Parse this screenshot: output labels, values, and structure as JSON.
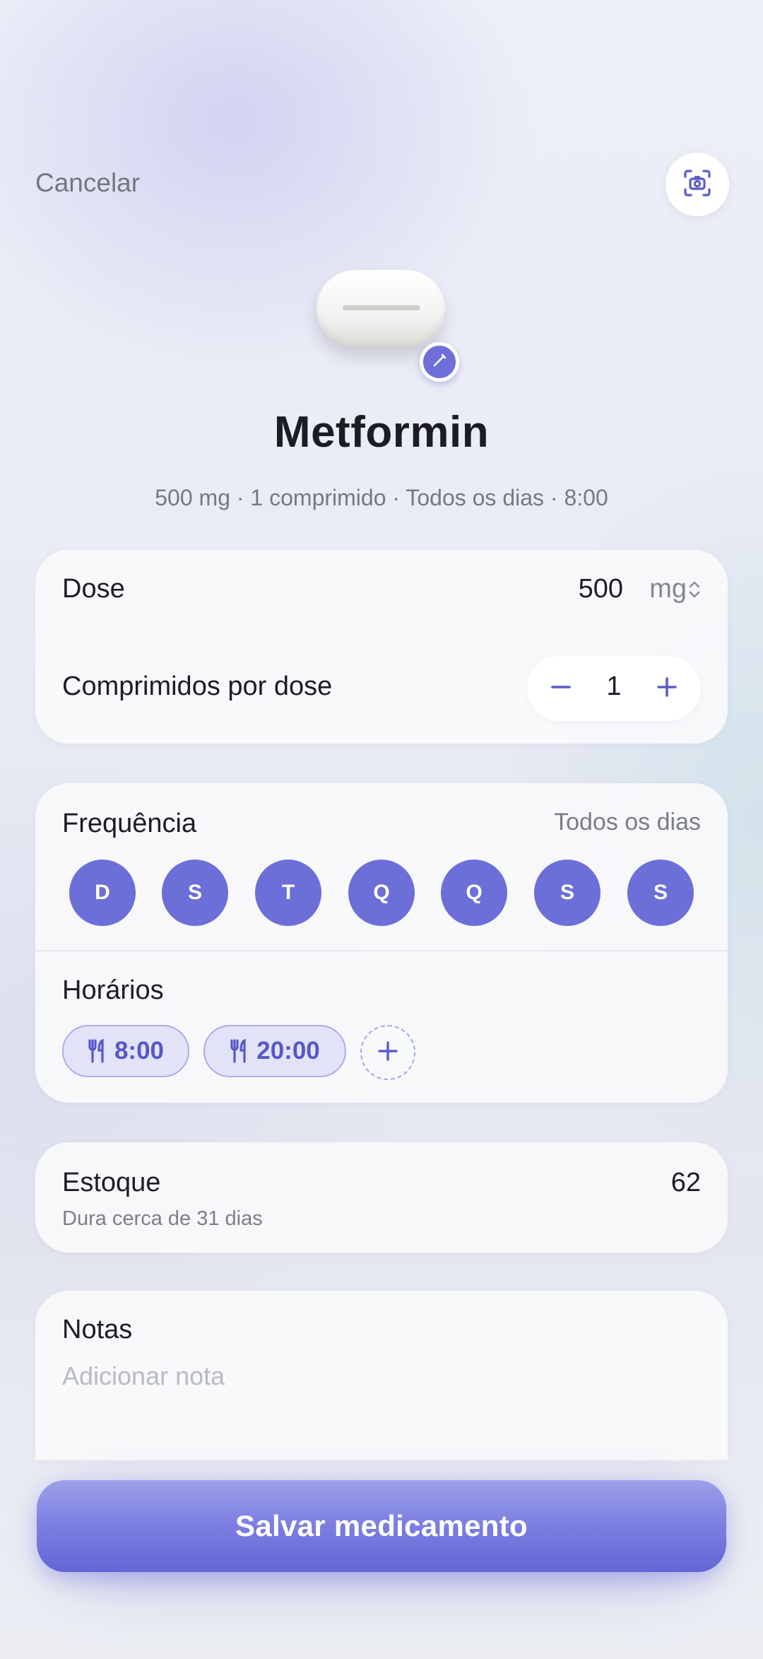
{
  "header": {
    "cancel_label": "Cancelar",
    "scan_icon": "camera-scan-icon"
  },
  "medication": {
    "pill_icon": "pill-icon",
    "edit_icon": "pencil-icon",
    "name": "Metformin",
    "summary": "500 mg · 1 comprimido · Todos os dias · 8:00"
  },
  "dose_card": {
    "dose_label": "Dose",
    "dose_value": "500",
    "dose_unit": "mg",
    "unit_icon": "chevron-up-down-icon",
    "pills_label": "Comprimidos por dose",
    "pills_value": "1",
    "minus_icon": "minus-icon",
    "plus_icon": "plus-icon"
  },
  "frequency_card": {
    "label": "Frequência",
    "value": "Todos os dias",
    "days": [
      {
        "letter": "D",
        "selected": true
      },
      {
        "letter": "S",
        "selected": true
      },
      {
        "letter": "T",
        "selected": true
      },
      {
        "letter": "Q",
        "selected": true
      },
      {
        "letter": "Q",
        "selected": true
      },
      {
        "letter": "S",
        "selected": true
      },
      {
        "letter": "S",
        "selected": true
      }
    ],
    "times_label": "Horários",
    "times": [
      {
        "time": "8:00",
        "icon": "fork-knife-icon"
      },
      {
        "time": "20:00",
        "icon": "fork-knife-icon"
      }
    ],
    "add_time_icon": "plus-icon"
  },
  "stock_card": {
    "label": "Estoque",
    "subtitle": "Dura cerca de 31 dias",
    "count": "62"
  },
  "notes_card": {
    "label": "Notas",
    "placeholder": "Adicionar nota"
  },
  "save_button": {
    "label": "Salvar medicamento"
  },
  "colors": {
    "accent": "#6c6fd8",
    "chip_bg": "#e2e3f8",
    "text": "#1c1d26",
    "muted": "#777982"
  }
}
